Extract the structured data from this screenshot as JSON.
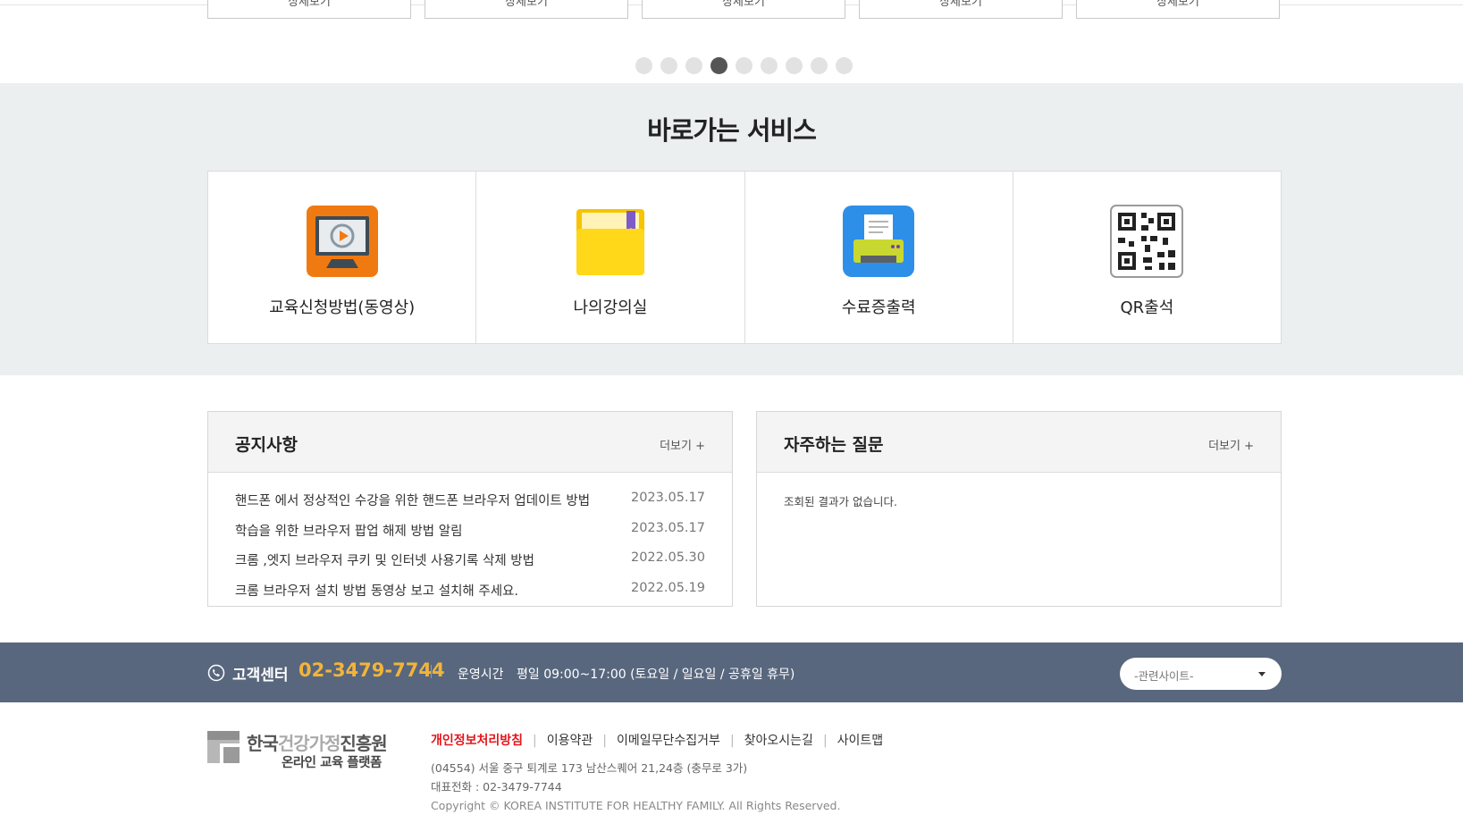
{
  "carousel": {
    "card_labels": [
      "상세보기",
      "상세보기",
      "상세보기",
      "상세보기",
      "상세보기"
    ],
    "dot_count": 9,
    "active_dot": 4
  },
  "quick_services": {
    "title": "바로가는 서비스",
    "items": [
      {
        "label": "교육신청방법(동영상)",
        "icon": "video-monitor-icon"
      },
      {
        "label": "나의강의실",
        "icon": "folder-icon"
      },
      {
        "label": "수료증출력",
        "icon": "printer-icon"
      },
      {
        "label": "QR출석",
        "icon": "qr-code-icon"
      }
    ]
  },
  "notice": {
    "title": "공지사항",
    "more": "더보기 +",
    "items": [
      {
        "title": "핸드폰 에서 정상적인 수강을 위한 핸드폰 브라우저 업데이트 방법",
        "date": "2023.05.17"
      },
      {
        "title": "학습을 위한 브라우저 팝업 해제 방법 알림",
        "date": "2023.05.17"
      },
      {
        "title": "크롬 ,엣지 브라우저 쿠키 및 인터넷 사용기록 삭제 방법",
        "date": "2022.05.30"
      },
      {
        "title": "크롬 브라우저 설치 방법 동영상 보고 설치해 주세요.",
        "date": "2022.05.19"
      }
    ]
  },
  "faq": {
    "title": "자주하는 질문",
    "more": "더보기 +",
    "empty_text": "조회된 결과가 없습니다."
  },
  "infobar": {
    "cs_label": "고객센터",
    "cs_number": "02-3479-7744",
    "hours_label": "운영시간",
    "hours": "평일 09:00~17:00 (토요일 / 일요일 / 공휴일 휴무)",
    "related_sites": "-관련사이트-",
    "accent": "#f2b43a",
    "background": "#58677e"
  },
  "footer": {
    "logo_main_a": "한국",
    "logo_main_b": "건강가정",
    "logo_main_c": "진흥원",
    "logo_sub": "온라인 교육 플랫폼",
    "links": [
      "개인정보처리방침",
      "이용약관",
      "이메일무단수집거부",
      "찾아오시는길",
      "사이트맵"
    ],
    "address": "(04554) 서울 중구 퇴계로 173 남산스퀘어 21,24층 (충무로 3가)",
    "tel": "대표전화 : 02-3479-7744",
    "copyright": "Copyright © KOREA INSTITUTE FOR HEALTHY FAMILY. All Rights Reserved."
  }
}
